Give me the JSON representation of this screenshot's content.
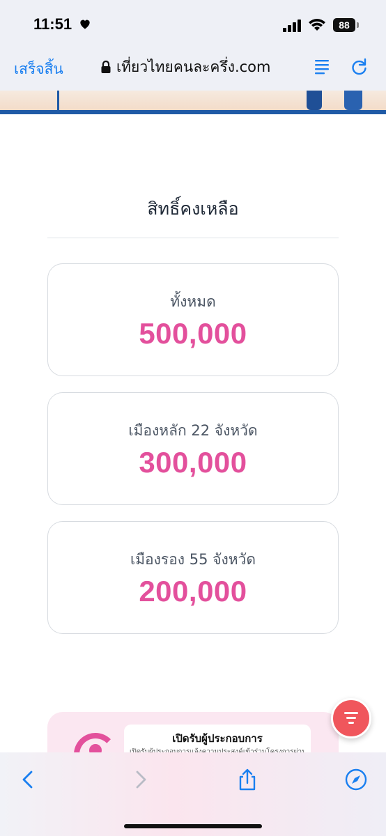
{
  "status_bar": {
    "time": "11:51",
    "battery": "88"
  },
  "browser": {
    "done_label": "เสร็จสิ้น",
    "url": "เที่ยวไทยคนละครึ่ง.com"
  },
  "main": {
    "section_title": "สิทธิ์คงเหลือ",
    "cards": [
      {
        "label": "ทั้งหมด",
        "value": "500,000"
      },
      {
        "label": "เมืองหลัก 22 จังหวัด",
        "value": "300,000"
      },
      {
        "label": "เมืองรอง 55 จังหวัด",
        "value": "200,000"
      }
    ]
  },
  "promo": {
    "title": "เปิดรับผู้ประกอบการ",
    "subtitle": "เปิดรับผู้ประกอบการแจ้งความประสงค์เข้าร่วมโครงการผ่าน"
  },
  "colors": {
    "accent": "#e3509c",
    "link": "#1a7ff0",
    "fab": "#f0565c"
  },
  "icons": {
    "lock": "lock-icon",
    "reader": "reader-icon",
    "reload": "reload-icon",
    "back": "chevron-left-icon",
    "forward": "chevron-right-icon",
    "share": "share-icon",
    "compass": "compass-icon",
    "chat": "chat-icon"
  }
}
